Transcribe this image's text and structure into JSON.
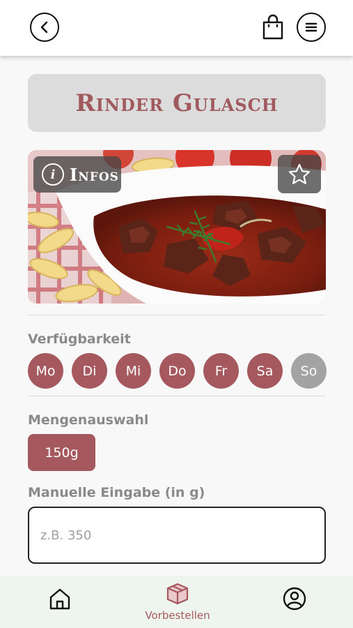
{
  "header": {
    "back_icon": "chevron-left-icon",
    "cart_icon": "shopping-bag-icon",
    "menu_icon": "hamburger-menu-icon"
  },
  "product": {
    "title": "Rinder Gulasch",
    "image_alt": "goulash-food-photo",
    "infos_label": "Infos",
    "info_icon": "info-icon",
    "favorite_icon": "star-icon"
  },
  "availability": {
    "label": "Verfügbarkeit",
    "days": [
      {
        "label": "Mo",
        "available": true
      },
      {
        "label": "Di",
        "available": true
      },
      {
        "label": "Mi",
        "available": true
      },
      {
        "label": "Do",
        "available": true
      },
      {
        "label": "Fr",
        "available": true
      },
      {
        "label": "Sa",
        "available": true
      },
      {
        "label": "So",
        "available": false
      }
    ]
  },
  "quantity": {
    "label": "Mengenauswahl",
    "options": [
      "150g"
    ]
  },
  "manual": {
    "label": "Manuelle Eingabe (in g)",
    "placeholder": "z.B. 350",
    "value": ""
  },
  "nav": {
    "home_icon": "home-icon",
    "order_icon": "box-icon",
    "order_label": "Vorbestellen",
    "profile_icon": "user-circle-icon"
  },
  "colors": {
    "accent": "#a5595e",
    "inactive": "#a3a3a3",
    "nav_bg": "#eef5ee"
  }
}
